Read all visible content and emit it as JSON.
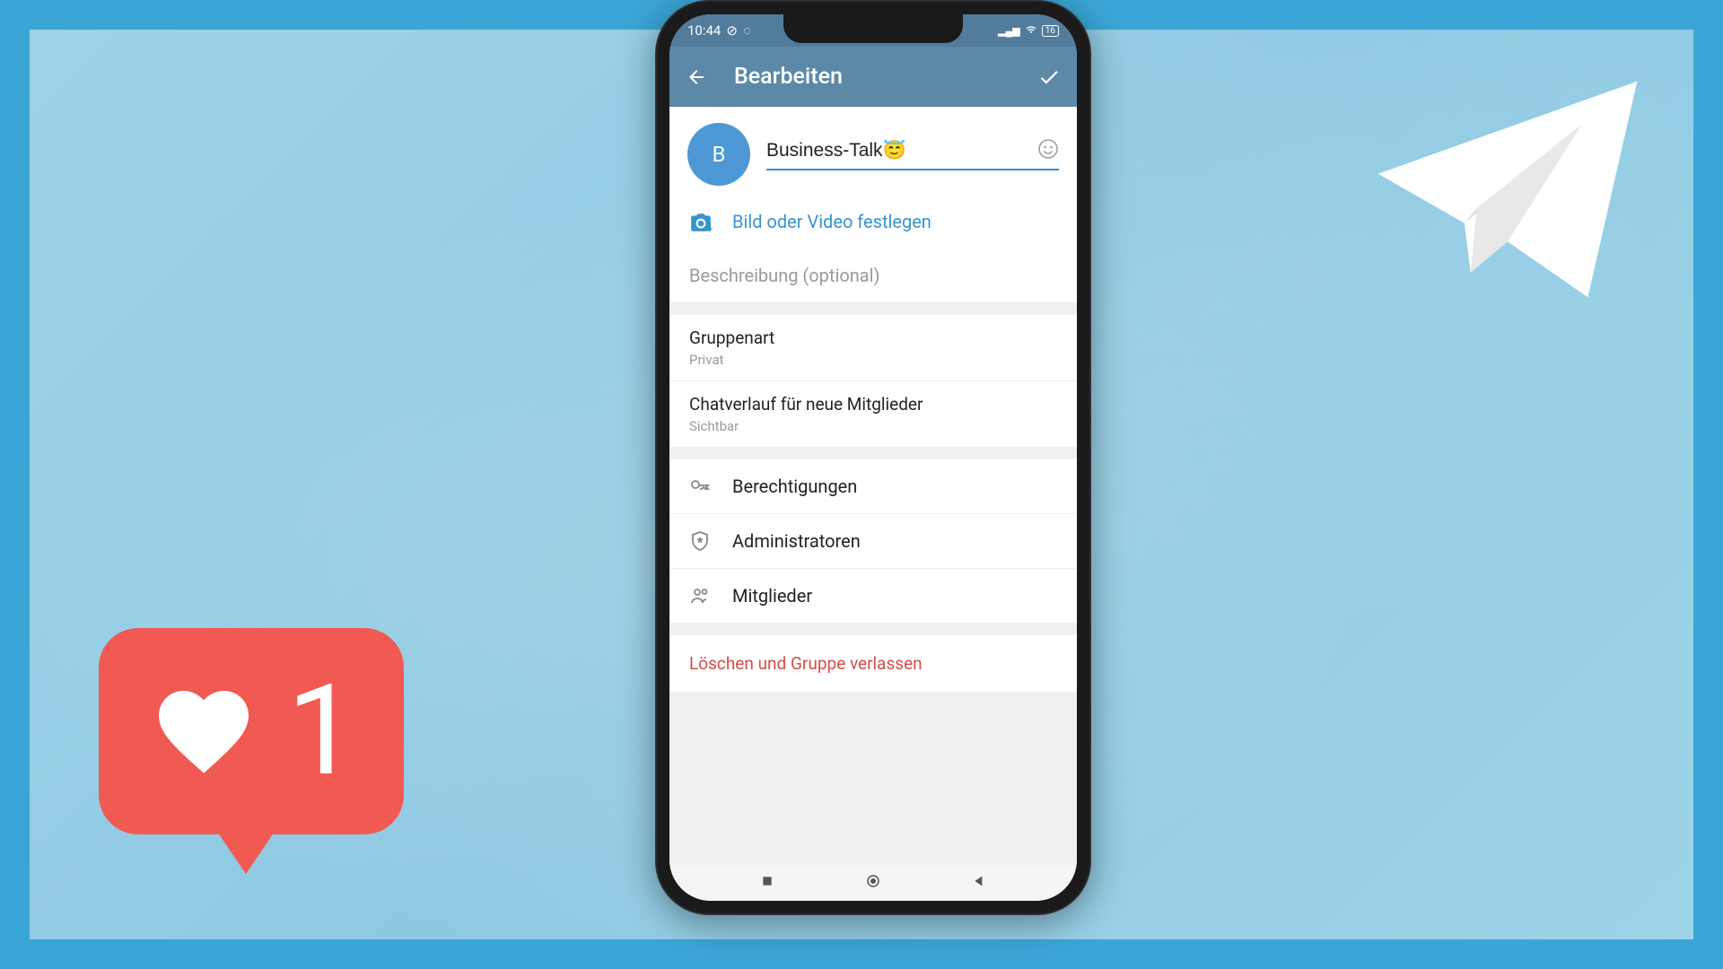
{
  "like": {
    "count": "1"
  },
  "statusBar": {
    "time": "10:44",
    "battery": "16"
  },
  "header": {
    "title": "Bearbeiten"
  },
  "group": {
    "avatarLetter": "B",
    "name": "Business-Talk😇",
    "setMedia": "Bild oder Video festlegen",
    "descriptionPlaceholder": "Beschreibung (optional)"
  },
  "settings": {
    "type": {
      "label": "Gruppenart",
      "value": "Privat"
    },
    "history": {
      "label": "Chatverlauf für neue Mitglieder",
      "value": "Sichtbar"
    }
  },
  "actions": {
    "permissions": "Berechtigungen",
    "admins": "Administratoren",
    "members": "Mitglieder"
  },
  "danger": {
    "deleteLeave": "Löschen und Gruppe verlassen"
  }
}
